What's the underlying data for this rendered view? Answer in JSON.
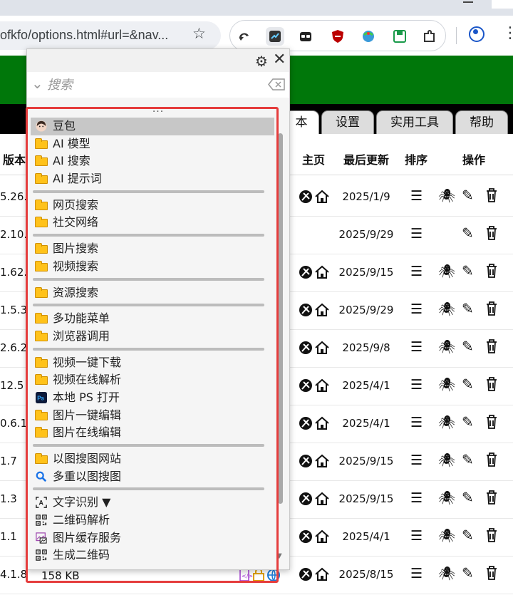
{
  "browser": {
    "url": "ofkfo/options.html#url=&nav...",
    "extension_icons": [
      "back-swirl-icon",
      "script-extension-icon",
      "sunglasses-icon",
      "shield-icon",
      "globe-bowl-icon",
      "save-icon",
      "puzzle-icon"
    ]
  },
  "nav_tabs": [
    "本",
    "设置",
    "实用工具",
    "帮助"
  ],
  "table": {
    "headers": {
      "version": "版本",
      "home": "主页",
      "updated": "最后更新",
      "sort": "排序",
      "actions": "操作"
    },
    "rows": [
      {
        "version": "5.26.",
        "date": "2025/1/9",
        "has_home": true,
        "has_bug": true
      },
      {
        "version": "2.10.",
        "date": "2025/9/29",
        "has_home": false,
        "has_bug": false
      },
      {
        "version": "1.62.",
        "date": "2025/9/15",
        "has_home": true,
        "has_bug": true
      },
      {
        "version": "1.5.3",
        "date": "2025/9/29",
        "has_home": true,
        "has_bug": true
      },
      {
        "version": "2.6.2",
        "date": "2025/9/8",
        "has_home": true,
        "has_bug": true
      },
      {
        "version": "12.5",
        "date": "2025/4/1",
        "has_home": true,
        "has_bug": true
      },
      {
        "version": "0.6.1",
        "date": "2025/4/1",
        "has_home": true,
        "has_bug": true
      },
      {
        "version": "1.7",
        "date": "2025/9/15",
        "has_home": true,
        "has_bug": true
      },
      {
        "version": "1.3",
        "date": "2025/9/15",
        "has_home": true,
        "has_bug": true
      },
      {
        "version": "1.1",
        "date": "2025/4/1",
        "has_home": true,
        "has_bug": true
      },
      {
        "version": "4.1.8",
        "date": "2025/8/15",
        "has_home": true,
        "has_bug": true,
        "size": "158 KB"
      }
    ],
    "sort_glyph": "☰"
  },
  "popup": {
    "search_placeholder": "搜索",
    "grip": "...",
    "groups": [
      [
        {
          "label": "豆包",
          "icon": "avatar-icon",
          "selected": true
        },
        {
          "label": "AI 模型",
          "icon": "folder-icon"
        },
        {
          "label": "AI 搜索",
          "icon": "folder-icon"
        },
        {
          "label": "AI 提示词",
          "icon": "folder-icon"
        }
      ],
      [
        {
          "label": "网页搜索",
          "icon": "folder-icon"
        },
        {
          "label": "社交网络",
          "icon": "folder-icon"
        }
      ],
      [
        {
          "label": "图片搜索",
          "icon": "folder-icon"
        },
        {
          "label": "视频搜索",
          "icon": "folder-icon"
        }
      ],
      [
        {
          "label": "资源搜索",
          "icon": "folder-icon"
        }
      ],
      [
        {
          "label": "多功能菜单",
          "icon": "folder-icon"
        },
        {
          "label": "浏览器调用",
          "icon": "folder-icon"
        }
      ],
      [
        {
          "label": "视频一键下载",
          "icon": "folder-icon"
        },
        {
          "label": "视频在线解析",
          "icon": "folder-icon"
        },
        {
          "label": "本地 PS 打开",
          "icon": "photoshop-icon"
        },
        {
          "label": "图片一键编辑",
          "icon": "folder-icon"
        },
        {
          "label": "图片在线编辑",
          "icon": "folder-icon"
        }
      ],
      [
        {
          "label": "以图搜图网站",
          "icon": "folder-icon"
        },
        {
          "label": "多重以图搜图",
          "icon": "magnifier-icon"
        }
      ],
      [
        {
          "label": "文字识别 ▼",
          "icon": "text-recognition-icon"
        },
        {
          "label": "二维码解析",
          "icon": "qrcode-icon"
        },
        {
          "label": "图片缓存服务",
          "icon": "image-cache-icon"
        },
        {
          "label": "生成二维码",
          "icon": "qrcode-icon"
        }
      ]
    ]
  },
  "colors": {
    "banner": "#00770a",
    "highlight": "#e53d3d",
    "folder": "#ffc21a"
  }
}
